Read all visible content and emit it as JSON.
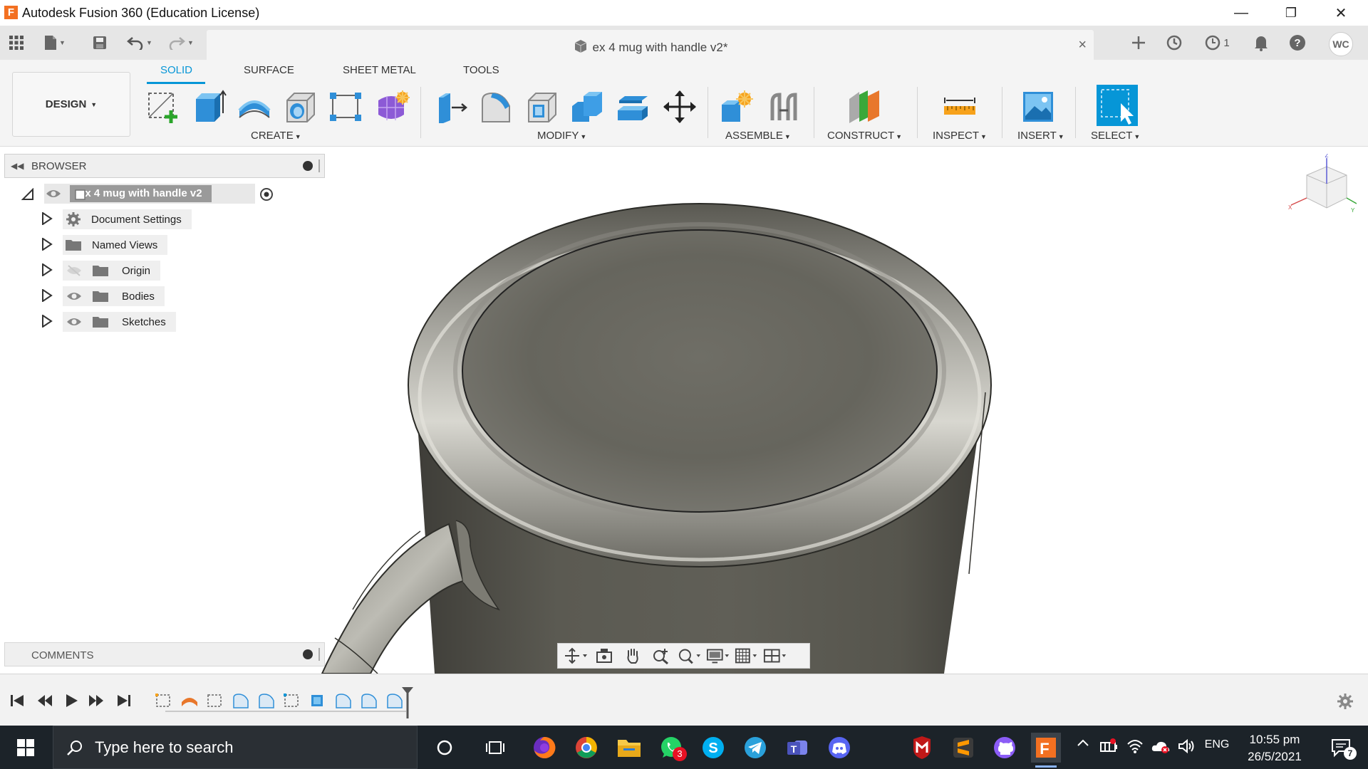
{
  "window": {
    "title": "Autodesk Fusion 360 (Education License)",
    "app_icon_letter": "F",
    "minimize": "—",
    "restore": "❐",
    "close": "✕"
  },
  "tabstrip": {
    "document_title": "ex 4 mug with handle v2*",
    "close_glyph": "×",
    "job_count": "1",
    "user_initials": "WC"
  },
  "toolbar": {
    "workspace": "DESIGN",
    "tabs": [
      "SOLID",
      "SURFACE",
      "SHEET METAL",
      "TOOLS"
    ],
    "active_tab": "SOLID",
    "groups": {
      "create": "CREATE",
      "modify": "MODIFY",
      "assemble": "ASSEMBLE",
      "construct": "CONSTRUCT",
      "inspect": "INSPECT",
      "insert": "INSERT",
      "select": "SELECT"
    },
    "caret": "▾"
  },
  "browser": {
    "header": "BROWSER",
    "root": "ex 4 mug with handle v2",
    "items": [
      "Document Settings",
      "Named Views",
      "Origin",
      "Bodies",
      "Sketches"
    ]
  },
  "comments": {
    "header": "COMMENTS"
  },
  "taskbar": {
    "search_placeholder": "Type here to search",
    "whatsapp_badge": "3",
    "language": "ENG",
    "time": "10:55 pm",
    "date": "26/5/2021",
    "notification_count": "7"
  },
  "colors": {
    "accent": "#0696d7",
    "mug_body": "#55544d",
    "taskbar": "#1c2329"
  }
}
